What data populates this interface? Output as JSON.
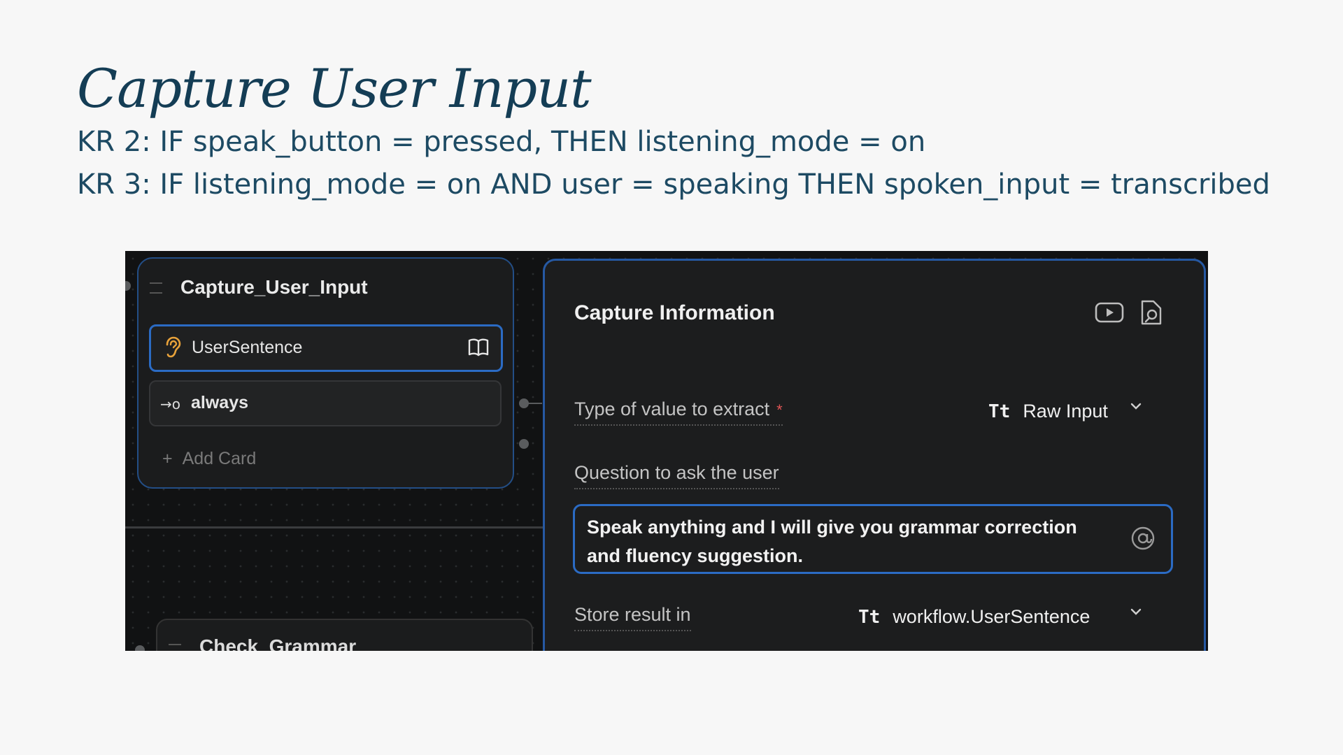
{
  "slide": {
    "title": "Capture User Input",
    "kr2": "KR 2: IF speak_button = pressed, THEN listening_mode = on",
    "kr3": "KR 3: IF listening_mode = on AND user = speaking THEN spoken_input = transcribed"
  },
  "node": {
    "title": "Capture_User_Input",
    "steps": [
      {
        "label": "UserSentence",
        "icon": "ear-icon",
        "action_icon": "book-icon"
      },
      {
        "label": "always",
        "icon": "arrow-icon"
      }
    ],
    "add_card": "Add Card"
  },
  "next_node": {
    "title": "Check_Grammar"
  },
  "panel": {
    "title": "Capture Information",
    "icons": [
      "youtube-icon",
      "document-search-icon"
    ],
    "type_label": "Type of value to extract",
    "required_mark": "*",
    "type_prefix": "Tt",
    "type_value": "Raw Input",
    "question_label": "Question to ask the user",
    "question_text": "Speak anything and I will give you grammar correction and fluency suggestion.",
    "store_label": "Store result in",
    "store_prefix": "Tt",
    "store_value": "workflow.UserSentence"
  },
  "colors": {
    "title": "#143d55",
    "accent_blue": "#2b6bc4",
    "ear_orange": "#e8a23a",
    "required_red": "#e05555"
  }
}
